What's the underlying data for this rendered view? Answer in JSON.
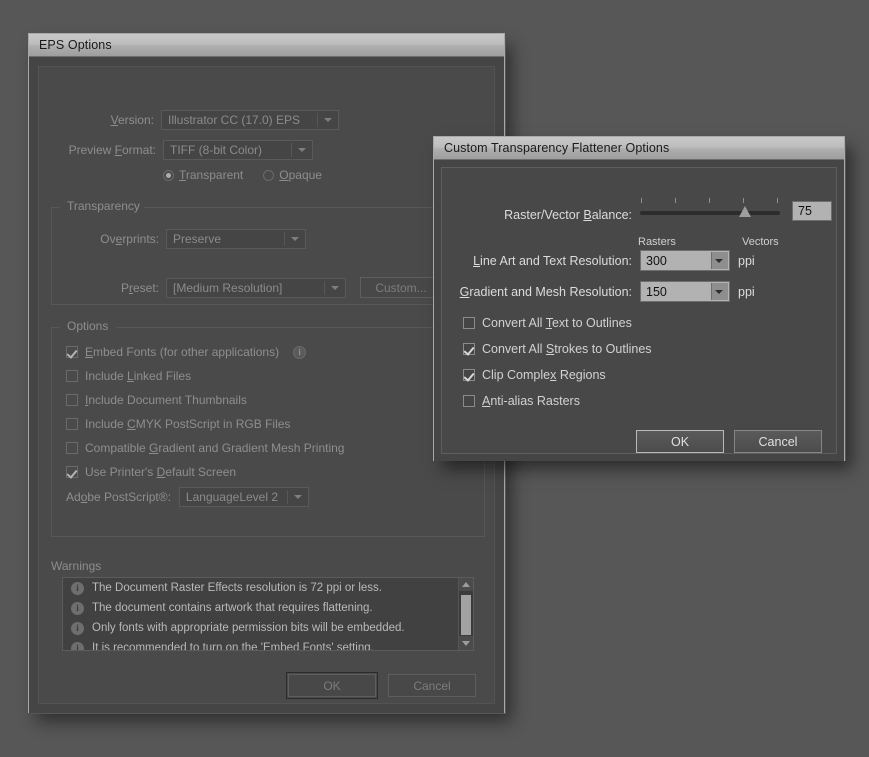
{
  "eps_dialog": {
    "title": "EPS Options",
    "version": {
      "label": "Version:",
      "label_mnemonic": "V",
      "value": "Illustrator CC (17.0) EPS"
    },
    "preview_format": {
      "label": "Preview Format:",
      "value": "TIFF (8-bit Color)"
    },
    "preview_mode": {
      "transparent": "Transparent",
      "opaque": "Opaque",
      "selected": "Transparent"
    },
    "transparency": {
      "legend": "Transparency",
      "overprints_label": "Overprints:",
      "overprints_value": "Preserve",
      "preset_label": "Preset:",
      "preset_value": "[Medium Resolution]",
      "custom_button": "Custom..."
    },
    "options": {
      "legend": "Options",
      "items": [
        {
          "label": "Embed Fonts (for other applications)",
          "checked": true,
          "info": true
        },
        {
          "label": "Include Linked Files",
          "checked": false,
          "info": false
        },
        {
          "label": "Include Document Thumbnails",
          "checked": false,
          "info": false
        },
        {
          "label": "Include CMYK PostScript in RGB Files",
          "checked": false,
          "info": false
        },
        {
          "label": "Compatible Gradient and Gradient Mesh Printing",
          "checked": false,
          "info": false
        },
        {
          "label": "Use Printer's Default Screen",
          "checked": true,
          "info": false
        }
      ],
      "postscript_label": "Adobe PostScript®:",
      "postscript_value": "LanguageLevel 2"
    },
    "warnings": {
      "legend": "Warnings",
      "items": [
        "The Document Raster Effects resolution is 72 ppi or less.",
        "The document contains artwork that requires flattening.",
        "Only fonts with appropriate permission bits will be embedded.",
        "It is recommended to turn on the 'Embed Fonts' setting,"
      ]
    },
    "buttons": {
      "ok": "OK",
      "cancel": "Cancel"
    }
  },
  "flattener_dialog": {
    "title": "Custom Transparency Flattener Options",
    "balance": {
      "label": "Raster/Vector Balance:",
      "value": "75",
      "min_label": "Rasters",
      "max_label": "Vectors",
      "percent": 75,
      "ticks": 5
    },
    "line_art": {
      "label": "Line Art and Text Resolution:",
      "value": "300",
      "unit": "ppi"
    },
    "gradient": {
      "label": "Gradient and Mesh Resolution:",
      "value": "150",
      "unit": "ppi"
    },
    "checkboxes": [
      {
        "label": "Convert All Text to Outlines",
        "checked": false
      },
      {
        "label": "Convert All Strokes to Outlines",
        "checked": true
      },
      {
        "label": "Clip Complex Regions",
        "checked": true
      },
      {
        "label": "Anti-alias Rasters",
        "checked": false
      }
    ],
    "buttons": {
      "ok": "OK",
      "cancel": "Cancel"
    }
  },
  "colors": {
    "desktop": "#575757",
    "dialog_body": "#454545",
    "titlebar": "#bdbdbd",
    "field_active": "#b2b2b2",
    "text_bright": "#dcdcdc",
    "text_dim": "#8e8e8e"
  }
}
